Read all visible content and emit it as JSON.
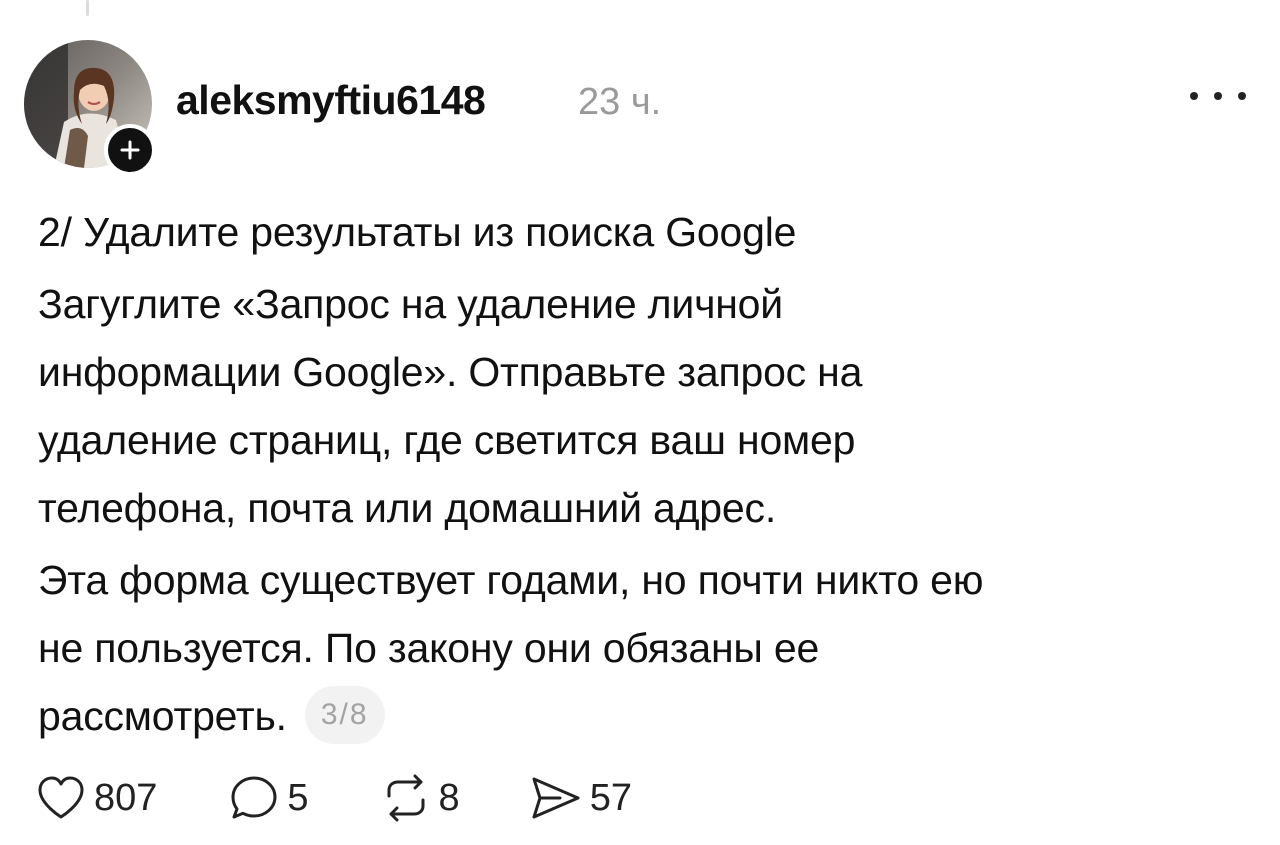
{
  "post": {
    "author": "aleksmyftiu6148",
    "time": "23 ч.",
    "text_lines": [
      "2/ Удалите результаты из поиска Google",
      "Загуглите «Запрос на удаление личной",
      "информации Google». Отправьте запрос на",
      "удаление страниц, где светится ваш номер",
      "телефона, почта или домашний адрес.",
      "Эта форма существует годами, но почти никто ею",
      "не пользуется. По закону они обязаны ее",
      "рассмотреть."
    ],
    "page_indicator": "3/8"
  },
  "actions": {
    "likes": "807",
    "replies": "5",
    "reposts": "8",
    "shares": "57"
  },
  "icons": {
    "follow": "plus-icon",
    "more": "more-horizontal-icon",
    "like": "heart-icon",
    "reply": "comment-bubble-icon",
    "repost": "repost-arrows-icon",
    "share": "send-icon"
  },
  "colors": {
    "text": "#111111",
    "muted": "#9a9a9a",
    "pill_bg": "#f2f2f2",
    "badge": "#111111"
  }
}
